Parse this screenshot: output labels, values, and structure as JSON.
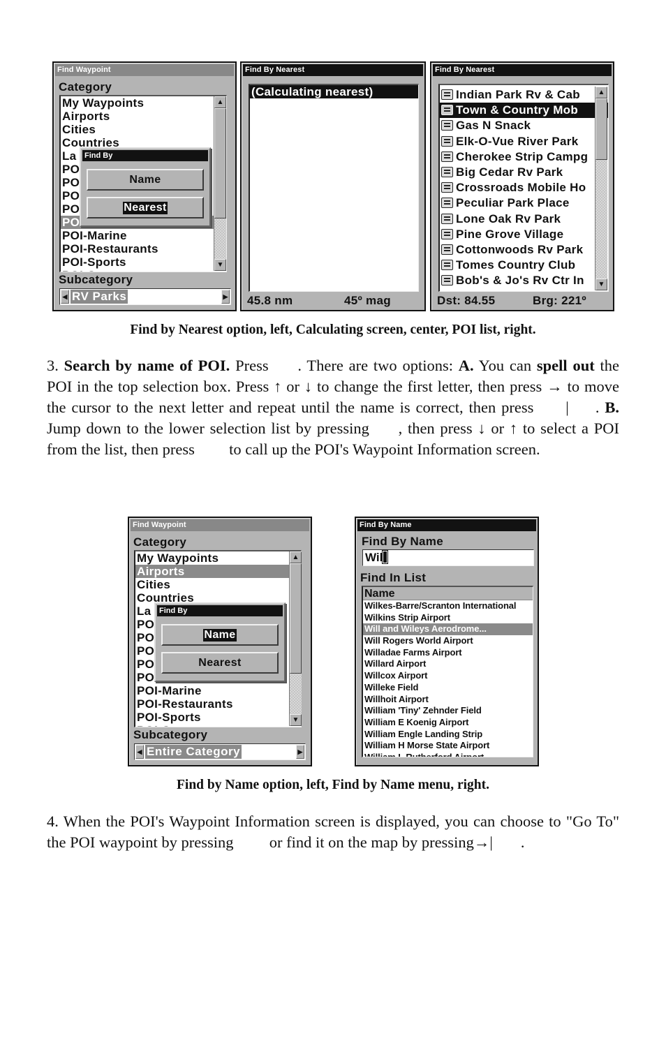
{
  "figure1": {
    "screen_left": {
      "title": "Find Waypoint",
      "category_label": "Category",
      "category_items": [
        "My Waypoints",
        "Airports",
        "Cities",
        "Countries",
        "La",
        "PO",
        "PO",
        "PO",
        "PO",
        "PO",
        "POI-Marine",
        "POI-Restaurants",
        "POI-Sports",
        "POI-S"
      ],
      "selected_index": 9,
      "subcategory_label": "Subcategory",
      "subcategory_value": "RV Parks",
      "popup": {
        "title": "Find By",
        "options": [
          "Name",
          "Nearest"
        ],
        "highlighted": "Nearest"
      },
      "scroll_position": 0.55
    },
    "screen_center": {
      "title": "Find By Nearest",
      "status_text": "(Calculating nearest)",
      "distance": "45.8 nm",
      "bearing": "45º mag"
    },
    "screen_right": {
      "title": "Find By Nearest",
      "items": [
        "Indian Park Rv & Cab",
        "Town & Country Mob",
        "Gas N Snack",
        "Elk-O-Vue River Park",
        "Cherokee Strip Campg",
        "Big Cedar Rv Park",
        "Crossroads Mobile Ho",
        "Peculiar Park Place",
        "Lone Oak Rv Park",
        "Pine Grove Village",
        "Cottonwoods Rv Park",
        "Tomes Country Club",
        "Bob's & Jo's Rv Ctr In"
      ],
      "selected_index": 1,
      "item_icon": "poi-campground-icon",
      "distance": "Dst: 84.55",
      "bearing": "Brg: 221º"
    },
    "caption": "Find by Nearest option, left, Calculating screen, center, POI list, right."
  },
  "paragraph3": {
    "number": "3.",
    "heading": "Search by name of POI.",
    "t1": " Press ",
    "t2": ". There are two options: ",
    "a_label": "A.",
    "t3": " You can ",
    "spell_out": "spell out",
    "t4": " the POI in the top selection box. Press ↑ or ↓ to change the first letter, then press → to move the cursor to the next letter and repeat until the name is correct, then press ",
    "sep": "|",
    "t5": ". ",
    "b_label": "B.",
    "t6": " Jump down to the lower selection list by pressing ",
    "t7": ", then press ↓ or ↑ to select a POI from the list, then press ",
    "t8": " to call up the POI's Waypoint Information screen."
  },
  "figure2": {
    "screen_left": {
      "title": "Find Waypoint",
      "category_label": "Category",
      "category_items": [
        "My Waypoints",
        "Airports",
        "Cities",
        "Countries",
        "La",
        "PO",
        "PO",
        "PO",
        "PO",
        "PO",
        "POI-Marine",
        "POI-Restaurants",
        "POI-Sports",
        "POI-S"
      ],
      "selected_index": 1,
      "subcategory_label": "Subcategory",
      "subcategory_value": "Entire Category",
      "popup": {
        "title": "Find By",
        "options": [
          "Name",
          "Nearest"
        ],
        "highlighted": "Name"
      },
      "scroll_position": 0.55
    },
    "screen_right": {
      "title": "Find By Name",
      "find_label": "Find By Name",
      "input_value": "Wil",
      "list_label": "Find In List",
      "column_header": "Name",
      "items": [
        "Wilkes-Barre/Scranton International",
        "Wilkins Strip Airport",
        "Will and Wileys Aerodrome...",
        "Will Rogers World Airport",
        "Willadae Farms Airport",
        "Willard Airport",
        "Willcox Airport",
        "Willeke Field",
        "Willhoit Airport",
        "William 'Tiny' Zehnder Field",
        "William E Koenig Airport",
        "William Engle Landing Strip",
        "William H Morse State Airport",
        "William L Rutherford Airport"
      ],
      "selected_index": 2
    },
    "caption": "Find by Name option, left, Find by Name menu, right."
  },
  "paragraph4": {
    "t1": "4. When the POI's Waypoint Information screen is displayed, you can choose to \"Go To\" the POI waypoint by pressing ",
    "t2": " or find it on the map by pressing",
    "arrow": "→|",
    "t3": "."
  }
}
